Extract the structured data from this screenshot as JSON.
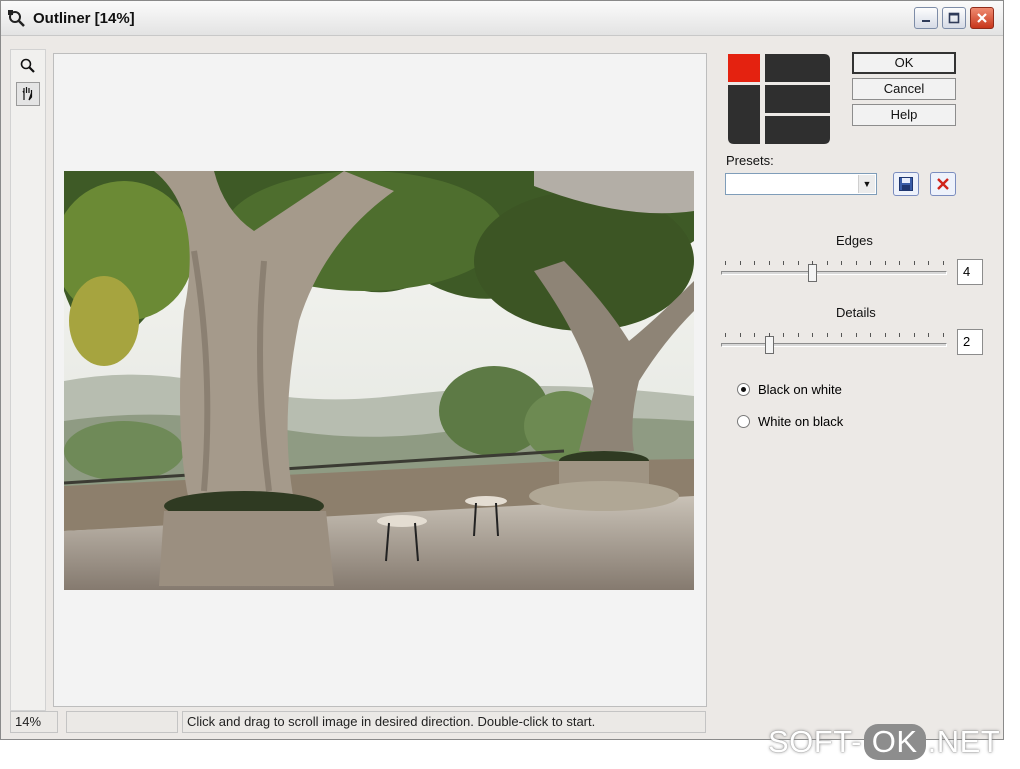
{
  "window": {
    "title": "Outliner [14%]"
  },
  "title_buttons": {
    "minimize": "minimize",
    "maximize": "maximize",
    "close": "close"
  },
  "tools": [
    {
      "icon": "magnifier-icon"
    },
    {
      "icon": "hand-icon"
    }
  ],
  "buttons": {
    "ok": "OK",
    "cancel": "Cancel",
    "help": "Help"
  },
  "presets": {
    "label": "Presets:",
    "value": ""
  },
  "edges": {
    "label": "Edges",
    "value": "4",
    "level": 0.4
  },
  "details": {
    "label": "Details",
    "value": "2",
    "level": 0.2
  },
  "mode": {
    "options": [
      {
        "label": "Black on white",
        "checked": true
      },
      {
        "label": "White on black",
        "checked": false
      }
    ]
  },
  "status": {
    "zoom": "14%",
    "empty": "",
    "message": "Click and drag to scroll image in desired direction. Double-click to start."
  },
  "watermark": {
    "part1": "SOFT-",
    "part2": "OK",
    "part3": ".NET"
  },
  "colors": {
    "logo_red": "#e42210",
    "logo_dark": "#2f2f2f",
    "window_bg": "#ece9e6"
  }
}
